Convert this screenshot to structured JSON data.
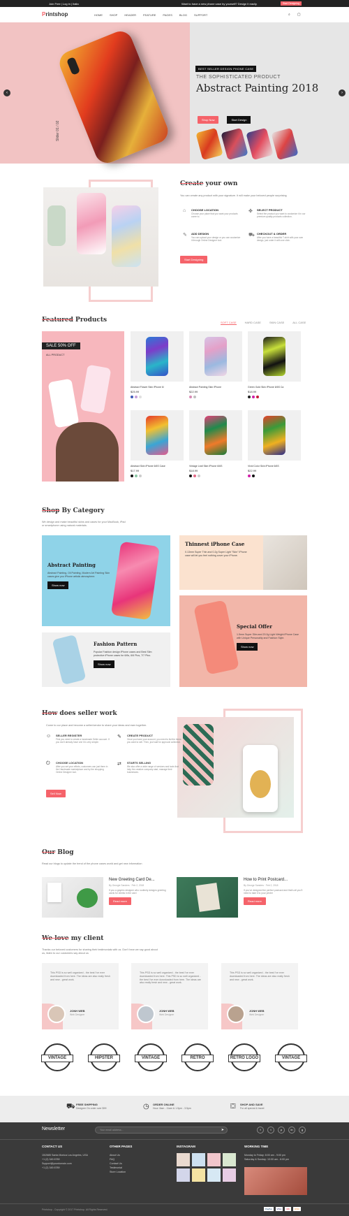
{
  "topbar": {
    "left": "Join Free   |   Log in   |   Italia",
    "middle": "Want to have a new phone case by yourself? Design it easily.",
    "cta": "Start Designing"
  },
  "header": {
    "logo_p": "P",
    "logo_rest": "rintshop",
    "nav": [
      "HOME",
      "SHOP",
      "HEADER",
      "FEATURE",
      "PAGES",
      "BLOG",
      "SUPPORT"
    ]
  },
  "hero": {
    "badge": "BEST SELLER DESIGN PHONE CASE",
    "subtitle": "THE SOPHISTICATED PRODUCT",
    "title": "Abstract Painting 2018",
    "btn_shop": "Shop Now",
    "btn_design": "Start Design",
    "slide": "Slider 01 / 02"
  },
  "create": {
    "title_strike": "Create",
    "title_rest": " your own",
    "desc": "You can create any product with your signature. It will make your beloved people surprising",
    "features": [
      {
        "icon": "location-icon",
        "title": "CHOOSE LOCATION",
        "desc": "Choose your place that you want your products come to."
      },
      {
        "icon": "product-icon",
        "title": "SELECT PRODUCT",
        "desc": "Select the product you want to customize it in our premium quality products collection."
      },
      {
        "icon": "design-icon",
        "title": "ADD DESIGN",
        "desc": "You can upload your design or you can customize it through Online Designer tool."
      },
      {
        "icon": "cart-icon",
        "title": "CHECKOUT & ORDER",
        "desc": "After you have a beautiful T-shirt with your own design, just order it with one click."
      }
    ],
    "btn": "Start Designing"
  },
  "featured": {
    "title_strike": "Featured",
    "title_rest": " Products",
    "tabs": [
      "SOFT CASE",
      "HARD CASE",
      "SKIN CASE",
      "ALL CASE"
    ],
    "sale": "SALE 50% OFF",
    "sale_sub": "ALL PRODUCT",
    "products": [
      {
        "name": "Abstract Flower Skin iPhone 6/",
        "price": "$25.99",
        "old": "$32.99",
        "colors": [
          "#3d5ab8",
          "#c7a0d8",
          "#e0e0e0"
        ],
        "case": "linear-gradient(160deg,#2a7bd6,#7d3cc9,#29b5c9,#3550c8)"
      },
      {
        "name": "Abstract Painting Skin iPhone",
        "price": "$22.99",
        "colors": [
          "#d88ab5",
          "#c0c0c0"
        ],
        "case": "linear-gradient(160deg,#d6c4e6,#e4a0c8,#9bb9e0,#f2d6e5)"
      },
      {
        "name": "Green Gold Skin iPhone 6/6S Ca",
        "price": "$18.99",
        "colors": [
          "#222",
          "#d11ea8",
          "#c41e3a"
        ],
        "case": "linear-gradient(160deg,#1a1a1a,#c8e03a,#111,#b6d92e)"
      },
      {
        "name": "Abstract Skin iPhone 6/6S Case",
        "price": "$17.99",
        "colors": [
          "#111",
          "#8ac7a4",
          "#ccc"
        ],
        "case": "linear-gradient(160deg,#e53a2a,#f2c030,#3aa5d5,#e55a8c)"
      },
      {
        "name": "Vintage Leaf Skin iPhone 6/6S",
        "price": "$18.99",
        "colors": [
          "#111",
          "#e36a87",
          "#ccc"
        ],
        "case": "linear-gradient(160deg,#e6407a,#1f8a4c,#f07a2a,#167a3a)"
      },
      {
        "name": "Vivid Color Skin iPhone 6/6S",
        "price": "$22.99",
        "colors": [
          "#d11ea8",
          "#111"
        ],
        "case": "linear-gradient(160deg,#e8402a,#3a9a3a,#f0b020,#2a2a8a)"
      }
    ]
  },
  "category": {
    "title_strike": "Shop",
    "title_rest": " By Category",
    "desc": "We design and make beautiful skins and cases for your MacBook, iPad or smartphone using natural materials.",
    "cards": [
      {
        "title": "Abstract Painting",
        "desc": "Abstract Painting, Oil Painting, Modern Art Painting Skin cases give you iPhone artistic atmosphere.",
        "btn": "Show now"
      },
      {
        "title": "Thinnest iPhone Case",
        "desc": "0.13mm Super Thin and 0.2g Super Light \"Skin\" iPhone case will let you feel nothing cover your iPhone."
      },
      {
        "title": "Fashion Pattern",
        "desc": "Popular Fashion design iPhone cases and Best Slim protective iPhone cases for 6/6s, 6/6 Plus, 7/7 Plus.",
        "btn": "Show now"
      },
      {
        "title": "Special Offer",
        "desc": "1.5mm Super Slim and 20.0g Light Weight iPhone Case with Unique Personality and Fashion Style.",
        "btn": "Show now"
      }
    ]
  },
  "seller": {
    "title_strike": "How",
    "title_rest": " does seller work",
    "desc": "Come to our place and become a seller/vendor to share your ideas and earn together.",
    "steps": [
      {
        "icon": "user-icon",
        "title": "SELLER REGISTER",
        "desc": "First you need to create a handmade Seller account. If you don't already have one it is very simple."
      },
      {
        "icon": "create-icon",
        "title": "CREATE PRODUCT",
        "desc": "Once you have your account, you need to list the items you want to sell. Then, just wait for approval collection."
      },
      {
        "icon": "power-icon",
        "title": "CHOOSE LOCATION",
        "desc": "After you set your efforts, customers can just them in the Handmade marketplace and by the shopping Online Designer tool."
      },
      {
        "icon": "sell-icon",
        "title": "STARTS SELLING",
        "desc": "We also offer a wide range of services and tools that help the creative company start, manage their businesses."
      }
    ],
    "btn": "Sell Now"
  },
  "blog": {
    "title_strike": "Our",
    "title_rest": " Blog",
    "desc": "Read our blogs to update the trend of the phone cases world and get new information",
    "posts": [
      {
        "title": "New Greeting Card De...",
        "meta": "By Georgie Sanders  ·  Feb 2, 2018",
        "desc": "If you a graphic designer who routinely designs greeting cards for clients in the card",
        "btn": "Read more"
      },
      {
        "title": "How to Print Postcard...",
        "meta": "By George Sanders  ·  Feb 2, 2018",
        "desc": "If you've designed the perfect postcard and that's all you'll need to take it to your printer",
        "btn": "Read more"
      }
    ]
  },
  "client": {
    "title_strike": "We love",
    "title_rest": " my client",
    "desc": "Thanks our beloved customers for sharing their testimonials with us. Don't hear we say good about us, listen to our customers say about us",
    "items": [
      {
        "quote": "This PSD is so well organized - the best I've ever downloaded from here. The ideas are also really fresh and new - great work.",
        "name": "JONH WEB",
        "role": "Web Designer"
      },
      {
        "quote": "This PSD is so well organized - the best I've ever downloaded from here. This PSD is so well organized - the best I've ever downloaded from here. The ideas are also really fresh and new - great work.",
        "name": "JONH WEB",
        "role": "Web Designer"
      },
      {
        "quote": "This PSD is so well organized - the best I've ever downloaded from here. The ideas are also really fresh and new - great work.",
        "name": "JONH WEB",
        "role": "Web Designer"
      }
    ],
    "logos": [
      "VINTAGE",
      "HIPSTER",
      "VINTAGE",
      "RETRO",
      "RETRO LOGO",
      "VINTAGE"
    ]
  },
  "service": [
    {
      "icon": "truck-icon",
      "title": "FREE SHIPPING",
      "desc": "Designer On order over $99"
    },
    {
      "icon": "clock-icon",
      "title": "ORDER ONLINE",
      "desc": "Hour: 8am - 11am & 1.5pm - 3.5pm"
    },
    {
      "icon": "bag-icon",
      "title": "SHOP AND SAVE",
      "desc": "For all special & travel"
    }
  ],
  "footer": {
    "newsletter": "Newsletter",
    "email_placeholder": "Your email address...",
    "socials": [
      "f",
      "t",
      "p",
      "in",
      "g"
    ],
    "contact_h": "CONTACT US",
    "contact": [
      "15/2685 Santa Monica Los Angeles, USA",
      "+1 (2) 345 6789",
      "Support@yourdomain.com",
      "+1 (2) 345 6789"
    ],
    "pages_h": "OTHER PAGES",
    "pages": [
      "About Us",
      "FAQ",
      "Contact Us",
      "Testimonial",
      "Store Location"
    ],
    "insta_h": "INSTAGRAM",
    "time_h": "WORKING TIME",
    "time": [
      "Monday to Friday: 8:00 am - 9:00 pm",
      "Saturday & Sunday: 10:00 am - 6:00 pm"
    ],
    "copyright": "Printshop - Copyright © 2017 Printshop. All Rights Reserved.",
    "payments": [
      "PayPal",
      "VISA",
      "MC",
      "DISC"
    ]
  }
}
